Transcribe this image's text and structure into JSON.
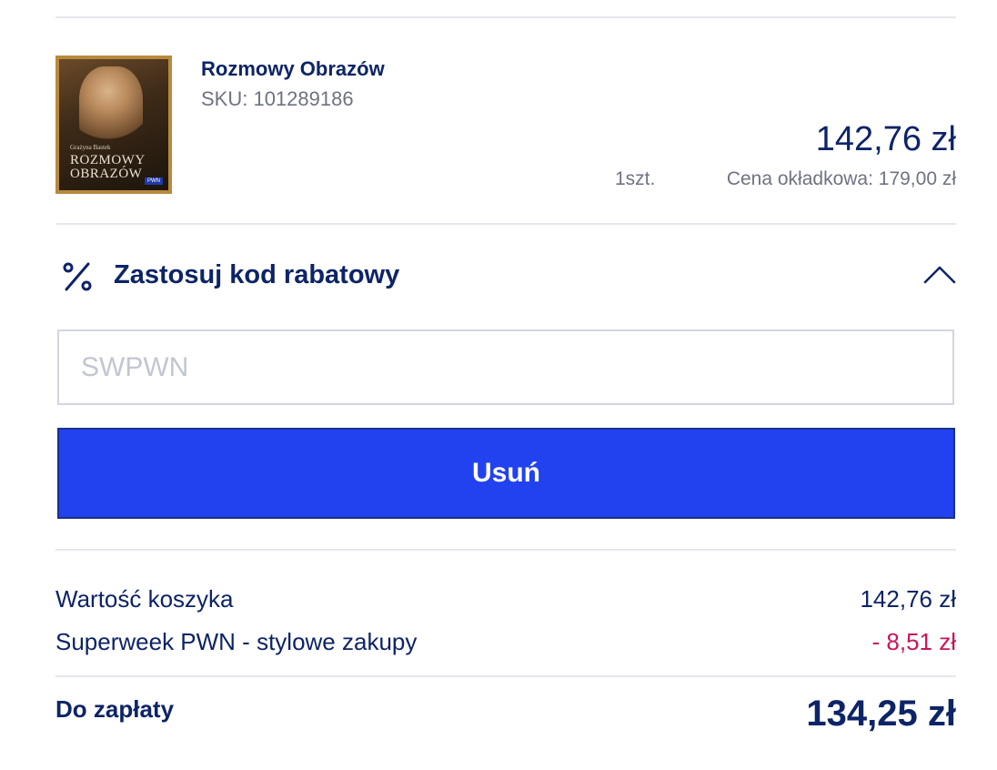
{
  "product": {
    "title": "Rozmowy Obrazów",
    "sku": "SKU: 101289186",
    "price": "142,76 zł",
    "quantity": "1szt.",
    "cover_price": "Cena okładkowa: 179,00 zł",
    "cover": {
      "author": "Grażyna Bastek",
      "title_line1": "ROZMOWY",
      "title_line2": "OBRAZÓW",
      "publisher": "PWN"
    }
  },
  "discount": {
    "icon": "percent-icon",
    "label": "Zastosuj kod rabatowy",
    "toggle_icon": "chevron-up-icon",
    "placeholder": "SWPWN",
    "button_label": "Usuń"
  },
  "summary": {
    "cart_value_label": "Wartość koszyka",
    "cart_value": "142,76 zł",
    "promo_label": "Superweek PWN - stylowe zakupy",
    "promo_value": "- 8,51 zł",
    "total_label": "Do zapłaty",
    "total_value": "134,25 zł"
  },
  "colors": {
    "navy": "#0d2466",
    "primary_button": "#2142ee",
    "discount_red": "#c8165a",
    "muted": "#6f7380"
  }
}
